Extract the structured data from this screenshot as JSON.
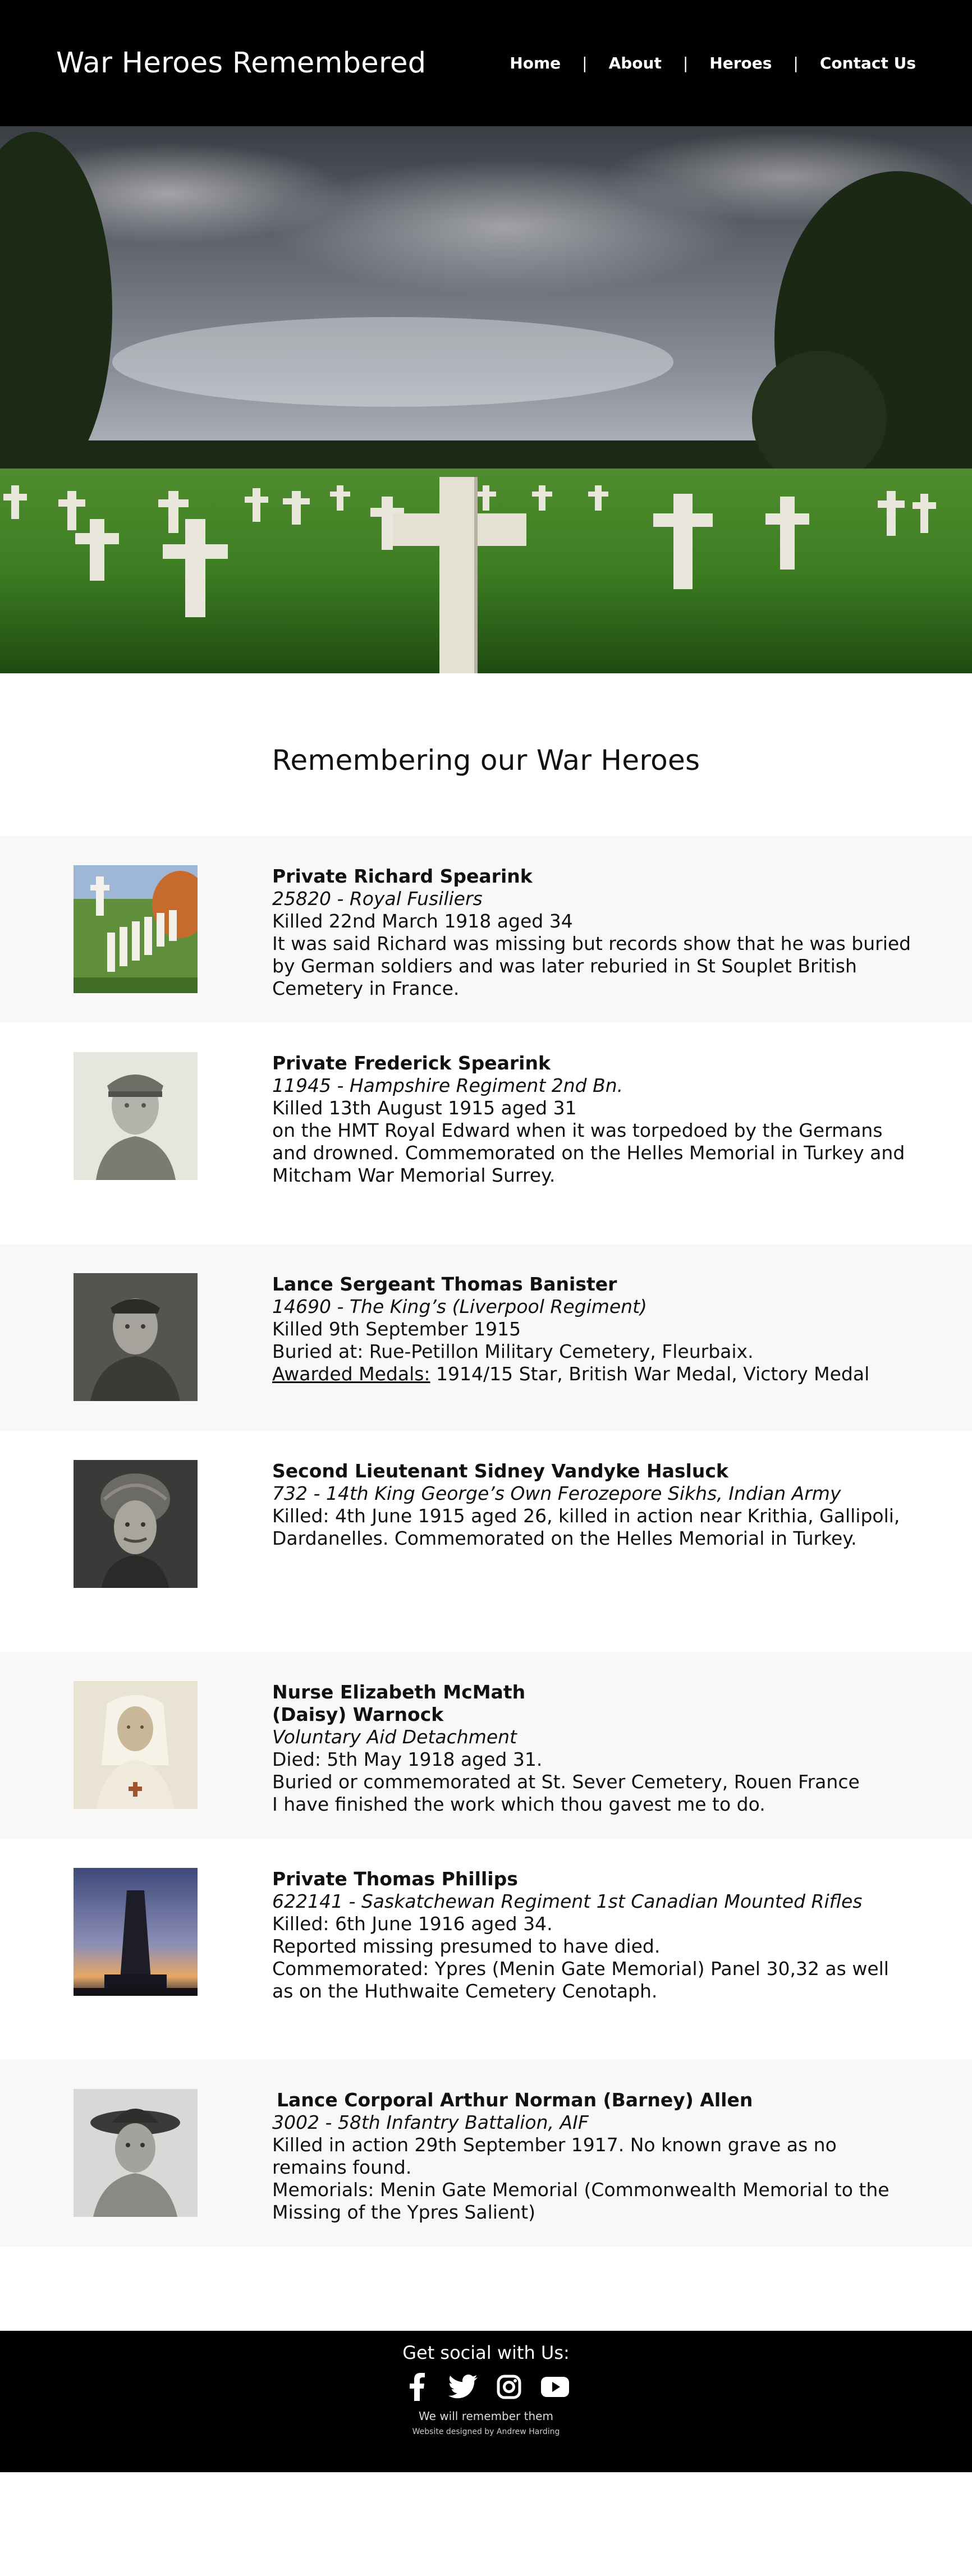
{
  "header": {
    "title": "War Heroes Remembered",
    "nav": [
      {
        "label": "Home"
      },
      {
        "label": "About"
      },
      {
        "label": "Heroes"
      },
      {
        "label": "Contact Us"
      }
    ],
    "separator": "|"
  },
  "hero_image": {
    "alt": "war-cemetery-crosses"
  },
  "intro": {
    "heading": "Remembering our War Heroes"
  },
  "heroes": [
    {
      "name": "Private Richard Spearink",
      "unit": "25820 - Royal Fusiliers",
      "lines": [
        "Killed 22nd March 1918 aged 34",
        "It was said Richard was missing but records show that he was buried by German soldiers and was later reburied in St Souplet British Cemetery in France."
      ],
      "image": "cemetery-photo"
    },
    {
      "name": "Private Frederick Spearink",
      "unit": "11945 - Hampshire Regiment 2nd Bn.",
      "lines": [
        "Killed 13th August 1915 aged 31",
        "on the HMT Royal Edward when it was torpedoed by the Germans and drowned. Commemorated on the Helles Memorial in Turkey and Mitcham War Memorial Surrey."
      ],
      "image": "soldier-portrait"
    },
    {
      "name": "Lance Sergeant Thomas Banister",
      "unit": "14690 - The King’s (Liverpool Regiment)",
      "lines": [
        "Killed 9th September 1915",
        "Buried at: Rue-Petillon Military Cemetery, Fleurbaix."
      ],
      "medals_label": "Awarded Medals:",
      "medals": " 1914/15 Star, British War Medal, Victory Medal",
      "image": "soldier-portrait"
    },
    {
      "name": "Second Lieutenant Sidney Vandyke Hasluck",
      "unit": "732 - 14th King George’s Own Ferozepore Sikhs, Indian Army",
      "lines": [
        "Killed: 4th June 1915 aged 26, killed in action near Krithia, Gallipoli, Dardanelles. Commemorated on the Helles Memorial in Turkey."
      ],
      "image": "turban-portrait"
    },
    {
      "name": "Nurse Elizabeth McMath",
      "name2": "(Daisy) Warnock",
      "unit": "Voluntary Aid Detachment",
      "lines": [
        "Died: 5th May 1918 aged 31.",
        "Buried or commemorated at St. Sever Cemetery, Rouen France",
        "I have finished the work which thou gavest me to do."
      ],
      "image": "nurse-portrait"
    },
    {
      "name": "Private Thomas Phillips",
      "unit": "622141 - Saskatchewan Regiment 1st Canadian Mounted Rifles",
      "lines": [
        "Killed: 6th June 1916 aged 34.",
        "Reported missing presumed to have died.",
        "Commemorated: Ypres (Menin Gate Memorial) Panel 30,32 as well as on the Huthwaite Cemetery Cenotaph."
      ],
      "image": "memorial-photo"
    },
    {
      "name": "Lance Corporal Arthur Norman (Barney) Allen",
      "unit": "3002 - 58th Infantry Battalion, AIF",
      "lines": [
        "Killed in action 29th September 1917. No known grave as no remains found.",
        "Memorials: Menin Gate Memorial (Commonwealth Memorial to the Missing of the Ypres Salient)"
      ],
      "image": "slouch-hat-portrait"
    }
  ],
  "footer": {
    "heading": "Get social with Us:",
    "socials": [
      "facebook-icon",
      "twitter-icon",
      "instagram-icon",
      "youtube-icon"
    ],
    "tagline": "We will remember them",
    "credit": "Website designed by Andrew Harding"
  }
}
